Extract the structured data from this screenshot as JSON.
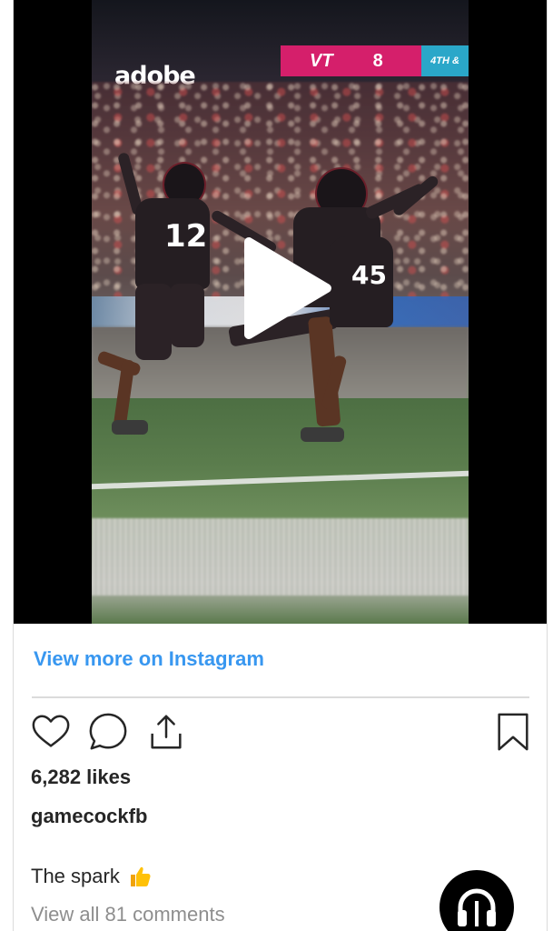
{
  "scoreboard": {
    "team": "VT",
    "score": "8",
    "quarter": "4TH &"
  },
  "arena_sign": "adobe",
  "players": [
    {
      "number": "12"
    },
    {
      "number": "45"
    }
  ],
  "post": {
    "view_more_label": "View more on Instagram",
    "likes": "6,282 likes",
    "username": "gamecockfb",
    "caption": "The spark",
    "comments_link": "View all 81 comments"
  },
  "icons": {
    "play": "play-icon",
    "like": "heart-icon",
    "comment": "comment-icon",
    "share": "share-icon",
    "save": "bookmark-icon",
    "emoji": "thumbs-up-emoji-icon",
    "fab": "headphones-icon"
  },
  "colors": {
    "link": "#3897f0",
    "scoreboard": "#d51f6b",
    "accent": "#2aa7c9"
  }
}
